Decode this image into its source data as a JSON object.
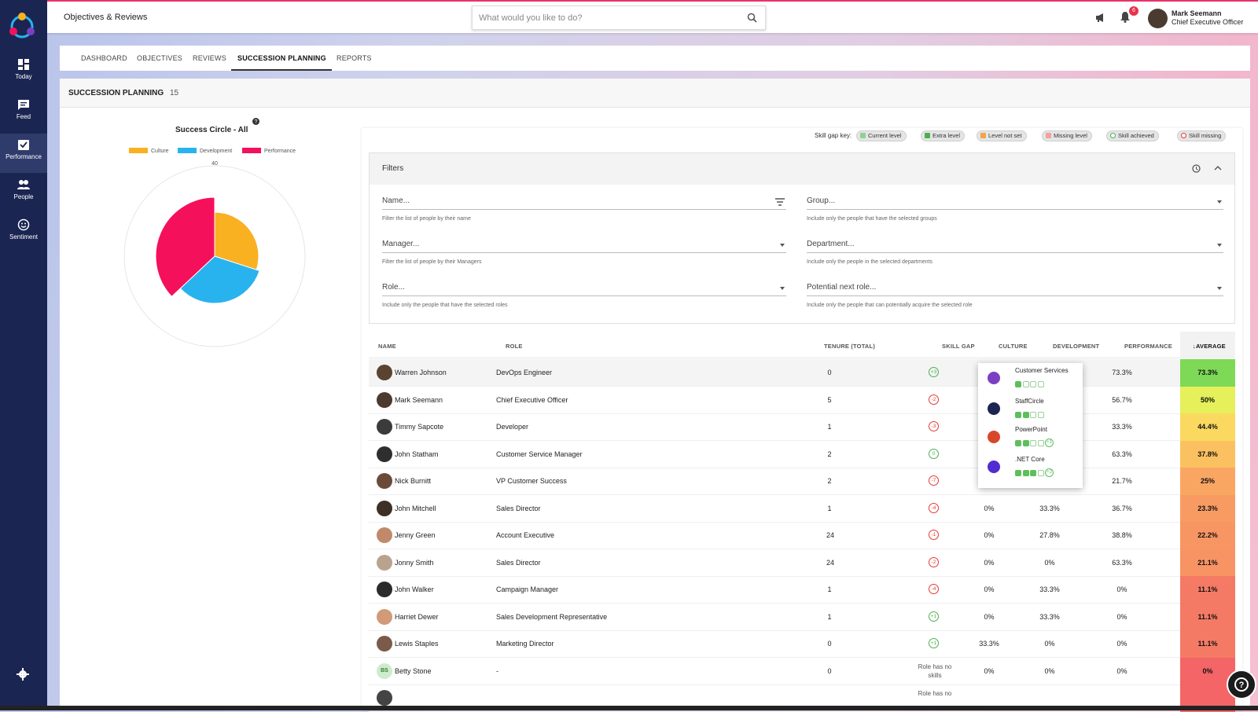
{
  "app": {
    "title": "Objectives & Reviews",
    "search_placeholder": "What would you like to do?",
    "notifications": "6",
    "user": {
      "name": "Mark Seemann",
      "role": "Chief Executive Officer"
    }
  },
  "sidebar": {
    "items": [
      {
        "label": "Today",
        "icon": "dashboard-icon"
      },
      {
        "label": "Feed",
        "icon": "chat-icon"
      },
      {
        "label": "Performance",
        "icon": "checkbox-icon"
      },
      {
        "label": "People",
        "icon": "people-icon"
      },
      {
        "label": "Sentiment",
        "icon": "smiley-icon"
      }
    ],
    "settings_icon": "gear-icon"
  },
  "tabs": [
    "DASHBOARD",
    "OBJECTIVES",
    "REVIEWS",
    "SUCCESSION PLANNING",
    "REPORTS"
  ],
  "page": {
    "title": "SUCCESSION PLANNING",
    "count": "15"
  },
  "chart_data": {
    "type": "pie",
    "title": "Success Circle - All",
    "legend": [
      "Culture",
      "Development",
      "Performance"
    ],
    "colors": [
      "#f9b122",
      "#29b3ee",
      "#f5105c"
    ],
    "values": [
      0.3,
      0.33,
      0.37
    ],
    "radial_max": "40",
    "radial_label": "1"
  },
  "skill_gap_key": {
    "label": "Skill gap key:",
    "items": [
      {
        "label": "Current level",
        "color": "#8fd18f"
      },
      {
        "label": "Extra level",
        "color": "#4caf50"
      },
      {
        "label": "Level not set",
        "color": "#f0a64a"
      },
      {
        "label": "Missing level",
        "color": "#f4a0a0"
      },
      {
        "label": "Skill achieved",
        "color": "#4caf50"
      },
      {
        "label": "Skill missing",
        "color": "#e53935"
      }
    ]
  },
  "filters": {
    "title": "Filters",
    "fields": [
      {
        "label": "Name...",
        "hint": "Filter the list of people by their name"
      },
      {
        "label": "Group...",
        "hint": "Include only the people that have the selected groups"
      },
      {
        "label": "Manager...",
        "hint": "Filter the list of people by their Managers"
      },
      {
        "label": "Department...",
        "hint": "Include only the people in the selected departments"
      },
      {
        "label": "Role...",
        "hint": "Include only the people that have the selected roles"
      },
      {
        "label": "Potential next role...",
        "hint": "Include only the people that can potentially acquire the selected role"
      }
    ]
  },
  "table": {
    "headers": [
      "NAME",
      "ROLE",
      "TENURE (TOTAL)",
      "SKILL GAP",
      "CULTURE",
      "DEVELOPMENT",
      "PERFORMANCE",
      "AVERAGE"
    ],
    "rows": [
      {
        "name": "Warren Johnson",
        "role": "DevOps Engineer",
        "tenure": "0",
        "gap": "+3",
        "culture": "",
        "development": "",
        "performance": "73.3%",
        "average": "73.3%",
        "avg_color": "#7ed957"
      },
      {
        "name": "Mark Seemann",
        "role": "Chief Executive Officer",
        "tenure": "5",
        "gap": "-2",
        "culture": "",
        "development": "",
        "performance": "56.7%",
        "average": "50%",
        "avg_color": "#e5f05a"
      },
      {
        "name": "Timmy Sapcote",
        "role": "Developer",
        "tenure": "1",
        "gap": "-3",
        "culture": "",
        "development": "",
        "performance": "33.3%",
        "average": "44.4%",
        "avg_color": "#fbd960"
      },
      {
        "name": "John Statham",
        "role": "Customer Service Manager",
        "tenure": "2",
        "gap": "0",
        "culture": "",
        "development": "",
        "performance": "63.3%",
        "average": "37.8%",
        "avg_color": "#fbc160"
      },
      {
        "name": "Nick Burnitt",
        "role": "VP Customer Success",
        "tenure": "2",
        "gap": "-7",
        "culture": "",
        "development": "",
        "performance": "21.7%",
        "average": "25%",
        "avg_color": "#f9a663"
      },
      {
        "name": "John Mitchell",
        "role": "Sales Director",
        "tenure": "1",
        "gap": "-4",
        "culture": "0%",
        "development": "33.3%",
        "performance": "36.7%",
        "average": "23.3%",
        "avg_color": "#f89b63"
      },
      {
        "name": "Jenny Green",
        "role": "Account Executive",
        "tenure": "24",
        "gap": "-1",
        "culture": "0%",
        "development": "27.8%",
        "performance": "38.8%",
        "average": "22.2%",
        "avg_color": "#f89663"
      },
      {
        "name": "Jonny Smith",
        "role": "Sales Director",
        "tenure": "24",
        "gap": "-2",
        "culture": "0%",
        "development": "0%",
        "performance": "63.3%",
        "average": "21.1%",
        "avg_color": "#f89364"
      },
      {
        "name": "John Walker",
        "role": "Campaign Manager",
        "tenure": "1",
        "gap": "-4",
        "culture": "0%",
        "development": "33.3%",
        "performance": "0%",
        "average": "11.1%",
        "avg_color": "#f57a65"
      },
      {
        "name": "Harriet Dewer",
        "role": "Sales Development Representative",
        "tenure": "1",
        "gap": "+1",
        "culture": "0%",
        "development": "33.3%",
        "performance": "0%",
        "average": "11.1%",
        "avg_color": "#f57a65"
      },
      {
        "name": "Lewis Staples",
        "role": "Marketing Director",
        "tenure": "0",
        "gap": "+1",
        "culture": "33.3%",
        "development": "0%",
        "performance": "0%",
        "average": "11.1%",
        "avg_color": "#f57a65"
      },
      {
        "name": "Betty Stone",
        "initials": "BS",
        "role": "-",
        "tenure": "0",
        "gap": "Role has no skills",
        "culture": "0%",
        "development": "0%",
        "performance": "0%",
        "average": "0%",
        "avg_color": "#f36566"
      },
      {
        "name": "",
        "role": "",
        "tenure": "",
        "gap": "Role has no",
        "culture": "",
        "development": "",
        "performance": "",
        "average": "",
        "avg_color": "#f36566"
      }
    ]
  },
  "popup": {
    "skills": [
      {
        "name": "Customer Services",
        "filled": 1,
        "empty": 3,
        "extra": "",
        "icon_color": "#7b3fc4"
      },
      {
        "name": "StaffCircle",
        "filled": 2,
        "empty": 2,
        "extra": "",
        "icon_color": "#1b2552"
      },
      {
        "name": "PowerPoint",
        "filled": 2,
        "empty": 2,
        "extra": "+1",
        "icon_color": "#d9472b"
      },
      {
        "name": ".NET Core",
        "filled": 3,
        "empty": 1,
        "extra": "+2",
        "icon_color": "#512bd4"
      }
    ]
  }
}
